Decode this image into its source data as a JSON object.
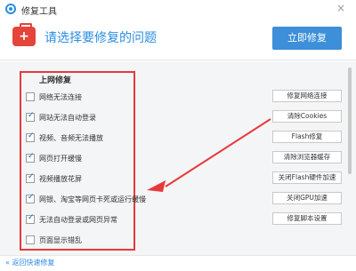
{
  "window": {
    "title": "修复工具",
    "close_glyph": "×"
  },
  "header": {
    "prompt": "请选择要修复的问题",
    "repair_now": "立即修复"
  },
  "section": {
    "title": "上网修复",
    "items": [
      {
        "label": "网络无法连接",
        "checked": false
      },
      {
        "label": "网站无法自动登录",
        "checked": true
      },
      {
        "label": "视频、音频无法播放",
        "checked": true
      },
      {
        "label": "网页打开缓慢",
        "checked": true
      },
      {
        "label": "视频播放花屏",
        "checked": true
      },
      {
        "label": "网银、淘宝等网页卡死或运行缓慢",
        "checked": true
      },
      {
        "label": "无法自动登录或网页异常",
        "checked": true
      },
      {
        "label": "页面显示错乱",
        "checked": false
      }
    ]
  },
  "fix_buttons": [
    "修复网络连接",
    "清除Cookies",
    "Flash修复",
    "清除浏览器缓存",
    "关闭Flash硬件加速",
    "关闭GPU加速",
    "修复脚本设置"
  ],
  "footer": {
    "back": "« 返回快速修复"
  },
  "colors": {
    "accent": "#2b8de2",
    "highlight": "#e8393a",
    "button_bg": "#3c8fd8"
  },
  "icons": {
    "app": "circle-logo-icon",
    "toolbox": "first-aid-kit-icon",
    "close": "close-icon"
  }
}
